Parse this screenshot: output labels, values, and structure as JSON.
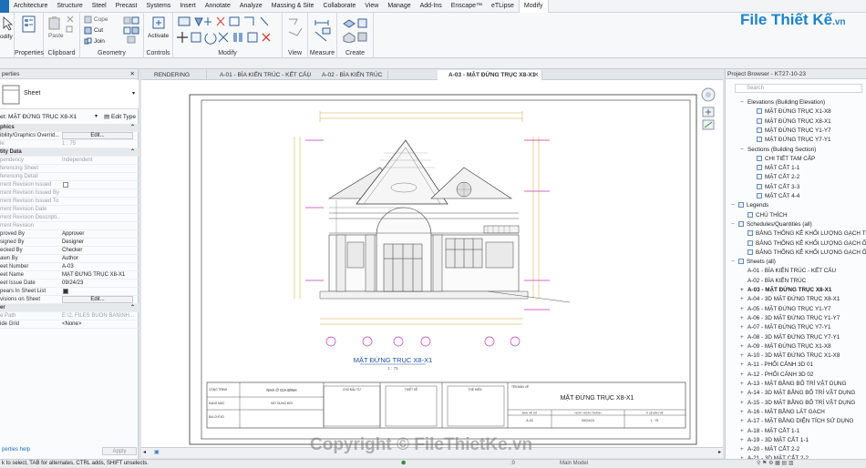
{
  "menubar": {
    "items": [
      "Architecture",
      "Structure",
      "Steel",
      "Precast",
      "Systems",
      "Insert",
      "Annotate",
      "Analyze",
      "Massing & Site",
      "Collaborate",
      "View",
      "Manage",
      "Add-Ins",
      "Enscape™",
      "eTLipse",
      "Modify"
    ],
    "active": "Modify"
  },
  "ribbon": {
    "modify_label": "odify",
    "groups": {
      "properties": "Properties",
      "clipboard": "Clipboard",
      "geometry": "Geometry",
      "controls": "Controls",
      "modify": "Modify",
      "view": "View",
      "measure": "Measure",
      "create": "Create"
    },
    "clipboard": {
      "paste": "Paste"
    },
    "geometry": {
      "cope": "Cope",
      "cut": "Cut",
      "join": "Join"
    },
    "controls": {
      "activate": "Activate"
    }
  },
  "logo": {
    "file": "File",
    "thiet": "Thiết Kế",
    "vn": ".vn"
  },
  "properties": {
    "title": "perties",
    "type_name": "Sheet",
    "selector": "et: MẶT ĐỨNG TRỤC X8-X1",
    "edit_type": "Edit Type",
    "rows": [
      {
        "k": "phics",
        "v": "",
        "head": true
      },
      {
        "k": "ibility/Graphics Overrid...",
        "btn": "Edit..."
      },
      {
        "k": "le",
        "v": "1 : 75",
        "dim": true
      },
      {
        "k": "tity Data",
        "v": "",
        "head": true
      },
      {
        "k": "pendency",
        "v": "Independent",
        "dim": true
      },
      {
        "k": "ferencing Sheet",
        "v": "",
        "dim": true
      },
      {
        "k": "ferencing Detail",
        "v": "",
        "dim": true
      },
      {
        "k": "rrent Revision Issued",
        "chk": false,
        "dim": true
      },
      {
        "k": "rrent Revision Issued By",
        "v": "",
        "dim": true
      },
      {
        "k": "rrent Revision Issued To",
        "v": "",
        "dim": true
      },
      {
        "k": "rrent Revision Date",
        "v": "",
        "dim": true
      },
      {
        "k": "rrent Revision Descripti...",
        "v": "",
        "dim": true
      },
      {
        "k": "rrent Revision",
        "v": "",
        "dim": true
      },
      {
        "k": "proved By",
        "v": "Approver"
      },
      {
        "k": "signed By",
        "v": "Designer"
      },
      {
        "k": "ecked By",
        "v": "Checker"
      },
      {
        "k": "awn By",
        "v": "Author"
      },
      {
        "k": "eet Number",
        "v": "A-03"
      },
      {
        "k": "eet Name",
        "v": "MẶT ĐỨNG TRỤC X8-X1"
      },
      {
        "k": "eet Issue Date",
        "v": "09/24/23"
      },
      {
        "k": "pears In Sheet List",
        "chk": true
      },
      {
        "k": "visions on Sheet",
        "btn": "Edit..."
      },
      {
        "k": "er",
        "v": "",
        "head": true
      },
      {
        "k": "e Path",
        "v": "E:\\2. FILES BUON BAN\\NH...",
        "dim": true
      },
      {
        "k": "ide Grid",
        "v": "<None>"
      }
    ],
    "help": "perties help",
    "apply": "Apply"
  },
  "tabs": [
    {
      "label": "RENDERING",
      "active": false
    },
    {
      "label": "A-01 - BÌA KIẾN TRÚC - KẾT CẤU",
      "active": false
    },
    {
      "label": "A-02 - BÌA KIẾN TRÚC",
      "active": false
    },
    {
      "label": "A-03 - MẶT ĐỨNG TRỤC X8-X1",
      "active": true
    }
  ],
  "drawing": {
    "title": "MẶT ĐỨNG TRỤC X8-X1",
    "scale": "1 : 75",
    "titleblock": {
      "cong_trinh": "CÔNG TRÌNH",
      "project": "NHÀ Ở GIA ĐÌNH",
      "hang_muc": "HẠNG MỤC",
      "hang_muc_val": "XÂY DỰNG MỚI",
      "dia_chi": "ĐỊA CHỈ XD",
      "chu_dau_tu": "CHỦ ĐẦU TƯ",
      "thiet_ke": "THIẾT KẾ",
      "thi_hien": "THỂ HIỆN",
      "ten_ban_ve": "TÊN BẢN VẼ",
      "sheet_title": "MẶT ĐỨNG TRỤC X8-X1",
      "ban_ve_so": "BẢN VẼ SỐ",
      "ngay": "NGÀY HOÀN THÀNH",
      "ti_le": "TỈ LỆ BẢN VẼ",
      "sheet_no": "A-03",
      "date": "09/24/23",
      "scale": "1 : 75"
    }
  },
  "browser": {
    "title": "Project Browser - KT27-10-23",
    "search_placeholder": "Search",
    "rows": [
      {
        "t": "Elevations (Building Elevation)",
        "lvl": 1,
        "exp": true
      },
      {
        "t": "MẶT ĐỨNG TRỤC X1-X8",
        "lvl": 2,
        "box": true
      },
      {
        "t": "MẶT ĐỨNG TRỤC X8-X1",
        "lvl": 2,
        "box": true
      },
      {
        "t": "MẶT ĐỨNG TRỤC Y1-Y7",
        "lvl": 2,
        "box": true
      },
      {
        "t": "MẶT ĐỨNG TRỤC Y7-Y1",
        "lvl": 2,
        "box": true
      },
      {
        "t": "Sections (Building Section)",
        "lvl": 1,
        "exp": true
      },
      {
        "t": "CHI TIẾT TAM CẤP",
        "lvl": 2,
        "box": true
      },
      {
        "t": "MẶT CẮT 1-1",
        "lvl": 2,
        "box": true
      },
      {
        "t": "MẶT CẮT 2-2",
        "lvl": 2,
        "box": true
      },
      {
        "t": "MẶT CẮT 3-3",
        "lvl": 2,
        "box": true
      },
      {
        "t": "MẶT CẮT 4-4",
        "lvl": 2,
        "box": true
      },
      {
        "t": "Legends",
        "lvl": 0,
        "exp": true,
        "box": true
      },
      {
        "t": "CHÚ THÍCH",
        "lvl": 1,
        "box": true
      },
      {
        "t": "Schedules/Quantities (all)",
        "lvl": 0,
        "exp": true,
        "box": true
      },
      {
        "t": "BẢNG THỐNG KÊ KHỐI LƯỢNG GẠCH THẺ T",
        "lvl": 1,
        "box": true
      },
      {
        "t": "BẢNG THỐNG KÊ KHỐI LƯỢNG GẠCH ỐNG T",
        "lvl": 1,
        "box": true
      },
      {
        "t": "BẢNG THỐNG KÊ KHỐI LƯỢNG GẠCH ỐNG T",
        "lvl": 1,
        "box": true
      },
      {
        "t": "Sheets (all)",
        "lvl": 0,
        "exp": true,
        "box": true
      },
      {
        "t": "A-01 - BÌA KIẾN TRÚC - KẾT CẤU",
        "lvl": 1
      },
      {
        "t": "A-02 - BÌA KIẾN TRÚC",
        "lvl": 1
      },
      {
        "t": "A-03 - MẶT ĐỨNG TRỤC X8-X1",
        "lvl": 1,
        "bold": true,
        "plus": true
      },
      {
        "t": "A-04 - 3D MẶT ĐỨNG TRỤC X8-X1",
        "lvl": 1,
        "plus": true
      },
      {
        "t": "A-05 - MẶT ĐỨNG TRỤC Y1-Y7",
        "lvl": 1,
        "plus": true
      },
      {
        "t": "A-06 - 3D MẶT ĐỨNG TRỤC Y1-Y7",
        "lvl": 1,
        "plus": true
      },
      {
        "t": "A-07 - MẶT ĐỨNG TRỤC Y7-Y1",
        "lvl": 1,
        "plus": true
      },
      {
        "t": "A-08 - 3D MẶT ĐỨNG TRỤC Y7-Y1",
        "lvl": 1,
        "plus": true
      },
      {
        "t": "A-09 - MẶT ĐỨNG TRỤC X1-X8",
        "lvl": 1,
        "plus": true
      },
      {
        "t": "A-10 - 3D MẶT ĐỨNG TRỤC X1-X8",
        "lvl": 1,
        "plus": true
      },
      {
        "t": "A-11 - PHỐI CẢNH 3D 01",
        "lvl": 1,
        "plus": true
      },
      {
        "t": "A-12 - PHỐI CẢNH 3D 02",
        "lvl": 1,
        "plus": true
      },
      {
        "t": "A-13 - MẶT BẰNG BỐ TRÍ VẬT DỤNG",
        "lvl": 1,
        "plus": true
      },
      {
        "t": "A-14 - 3D MẶT BẰNG BỐ TRÍ VẬT DỤNG",
        "lvl": 1,
        "plus": true
      },
      {
        "t": "A-15 - 3D MẶT BẰNG BỐ TRÍ VẬT DỤNG",
        "lvl": 1,
        "plus": true
      },
      {
        "t": "A-16 - MẶT BẰNG LÁT GẠCH",
        "lvl": 1,
        "plus": true
      },
      {
        "t": "A-17 - MẶT BẰNG DIỆN TÍCH SỬ DỤNG",
        "lvl": 1,
        "plus": true
      },
      {
        "t": "A-18 - MẶT CẮT 1-1",
        "lvl": 1,
        "plus": true
      },
      {
        "t": "A-19 - 3D MẶT CẮT 1-1",
        "lvl": 1,
        "plus": true
      },
      {
        "t": "A-20 - MẶT CẮT 2-2",
        "lvl": 1,
        "plus": true
      },
      {
        "t": "A-21 - 3D MẶT CẮT 2-2",
        "lvl": 1,
        "plus": true
      }
    ]
  },
  "status": {
    "hint": "k to select, TAB for alternates, CTRL adds, SHIFT unselects.",
    "model": "Main Model",
    "coord": ":0"
  },
  "watermark": "Copyright © FileThietKe.vn"
}
